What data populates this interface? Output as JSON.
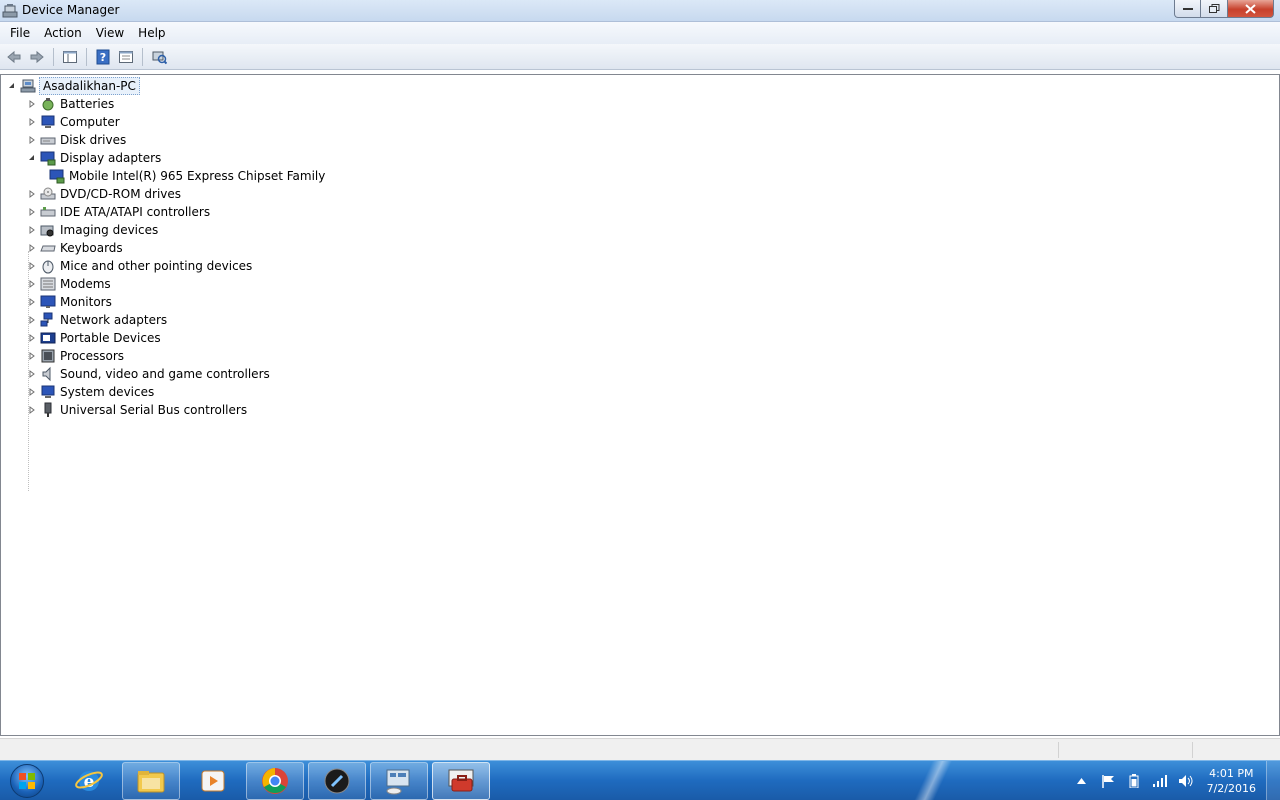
{
  "window": {
    "title": "Device Manager"
  },
  "menu": {
    "items": [
      "File",
      "Action",
      "View",
      "Help"
    ]
  },
  "toolbar": {
    "buttons": [
      "back-icon",
      "forward-icon",
      "show-hide-console-tree-icon",
      "help-icon",
      "properties-icon",
      "scan-hardware-icon"
    ]
  },
  "tree": {
    "root": "Asadalikhan-PC",
    "categories": [
      {
        "label": "Batteries",
        "icon": "battery-icon",
        "expanded": false
      },
      {
        "label": "Computer",
        "icon": "computer-icon",
        "expanded": false
      },
      {
        "label": "Disk drives",
        "icon": "disk-drive-icon",
        "expanded": false
      },
      {
        "label": "Display adapters",
        "icon": "display-adapter-icon",
        "expanded": true
      },
      {
        "label": "Mobile Intel(R) 965 Express Chipset Family",
        "icon": "display-adapter-icon",
        "child": true
      },
      {
        "label": "DVD/CD-ROM drives",
        "icon": "dvd-drive-icon",
        "expanded": false
      },
      {
        "label": "IDE ATA/ATAPI controllers",
        "icon": "ide-controller-icon",
        "expanded": false
      },
      {
        "label": "Imaging devices",
        "icon": "camera-icon",
        "expanded": false
      },
      {
        "label": "Keyboards",
        "icon": "keyboard-icon",
        "expanded": false
      },
      {
        "label": "Mice and other pointing devices",
        "icon": "mouse-icon",
        "expanded": false
      },
      {
        "label": "Modems",
        "icon": "modem-icon",
        "expanded": false
      },
      {
        "label": "Monitors",
        "icon": "monitor-icon",
        "expanded": false
      },
      {
        "label": "Network adapters",
        "icon": "network-adapter-icon",
        "expanded": false
      },
      {
        "label": "Portable Devices",
        "icon": "portable-device-icon",
        "expanded": false
      },
      {
        "label": "Processors",
        "icon": "processor-icon",
        "expanded": false
      },
      {
        "label": "Sound, video and game controllers",
        "icon": "speaker-icon",
        "expanded": false
      },
      {
        "label": "System devices",
        "icon": "system-device-icon",
        "expanded": false
      },
      {
        "label": "Universal Serial Bus controllers",
        "icon": "usb-icon",
        "expanded": false
      }
    ]
  },
  "taskbar": {
    "apps": [
      "internet-explorer-icon",
      "file-explorer-icon",
      "media-player-icon",
      "chrome-icon",
      "app-icon",
      "remote-desktop-icon",
      "device-manager-taskbar-icon"
    ],
    "clock": {
      "time": "4:01 PM",
      "date": "7/2/2016"
    }
  },
  "colors": {
    "taskbar": "#1f6bbf",
    "selection_bg": "#e8f1fb",
    "selection_border": "#7da2ce"
  }
}
